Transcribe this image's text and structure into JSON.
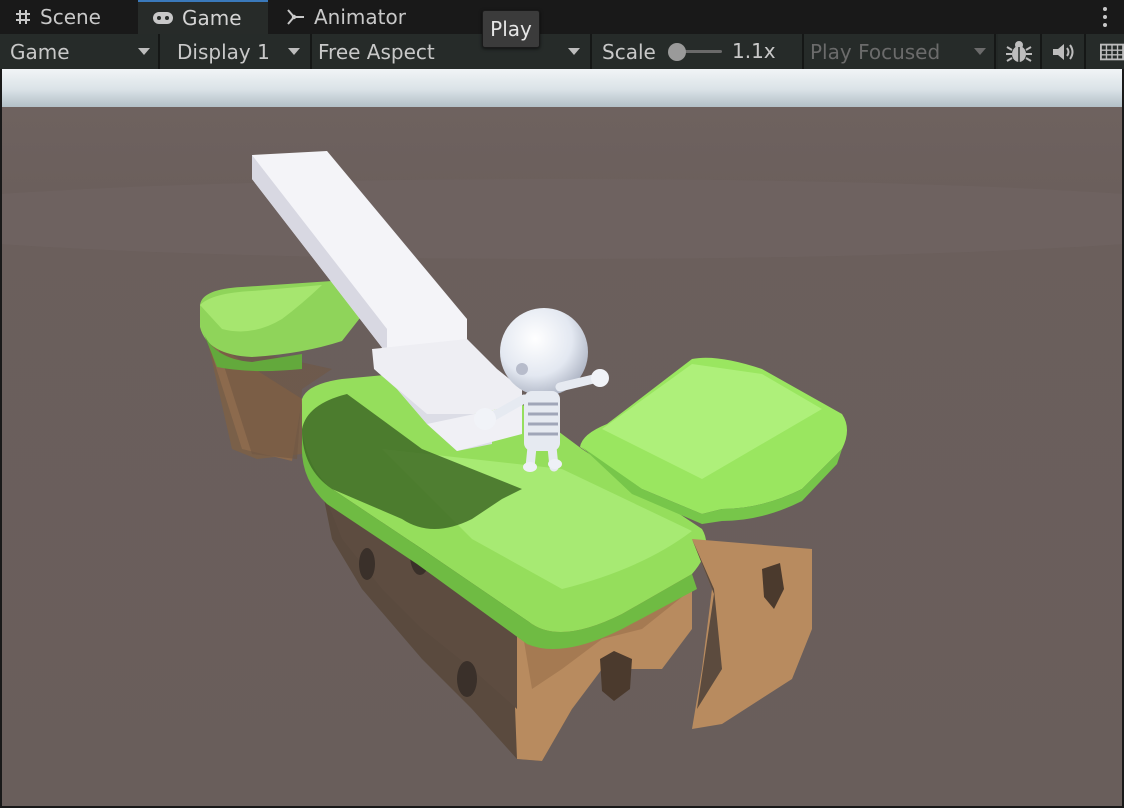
{
  "tabs": [
    {
      "label": "Scene",
      "icon": "grid-hash-icon"
    },
    {
      "label": "Game",
      "icon": "gamepad-icon",
      "active": true
    },
    {
      "label": "Animator",
      "icon": "animator-icon"
    }
  ],
  "toolbar": {
    "view_mode": "Game",
    "display": "Display 1",
    "aspect": "Free Aspect",
    "scale_label": "Scale",
    "scale_value": "1.1x",
    "play_mode": "Play Focused",
    "icons": [
      "bug-icon",
      "audio-icon",
      "stats-icon"
    ]
  },
  "tooltip": {
    "text": "Play"
  },
  "colors": {
    "accent": "#3a79bb",
    "ground": "#6b5f5c",
    "horizon": "#dfe5ea",
    "grass": "#9fe566",
    "dirt": "#a98259",
    "ramp": "#ececf0"
  }
}
